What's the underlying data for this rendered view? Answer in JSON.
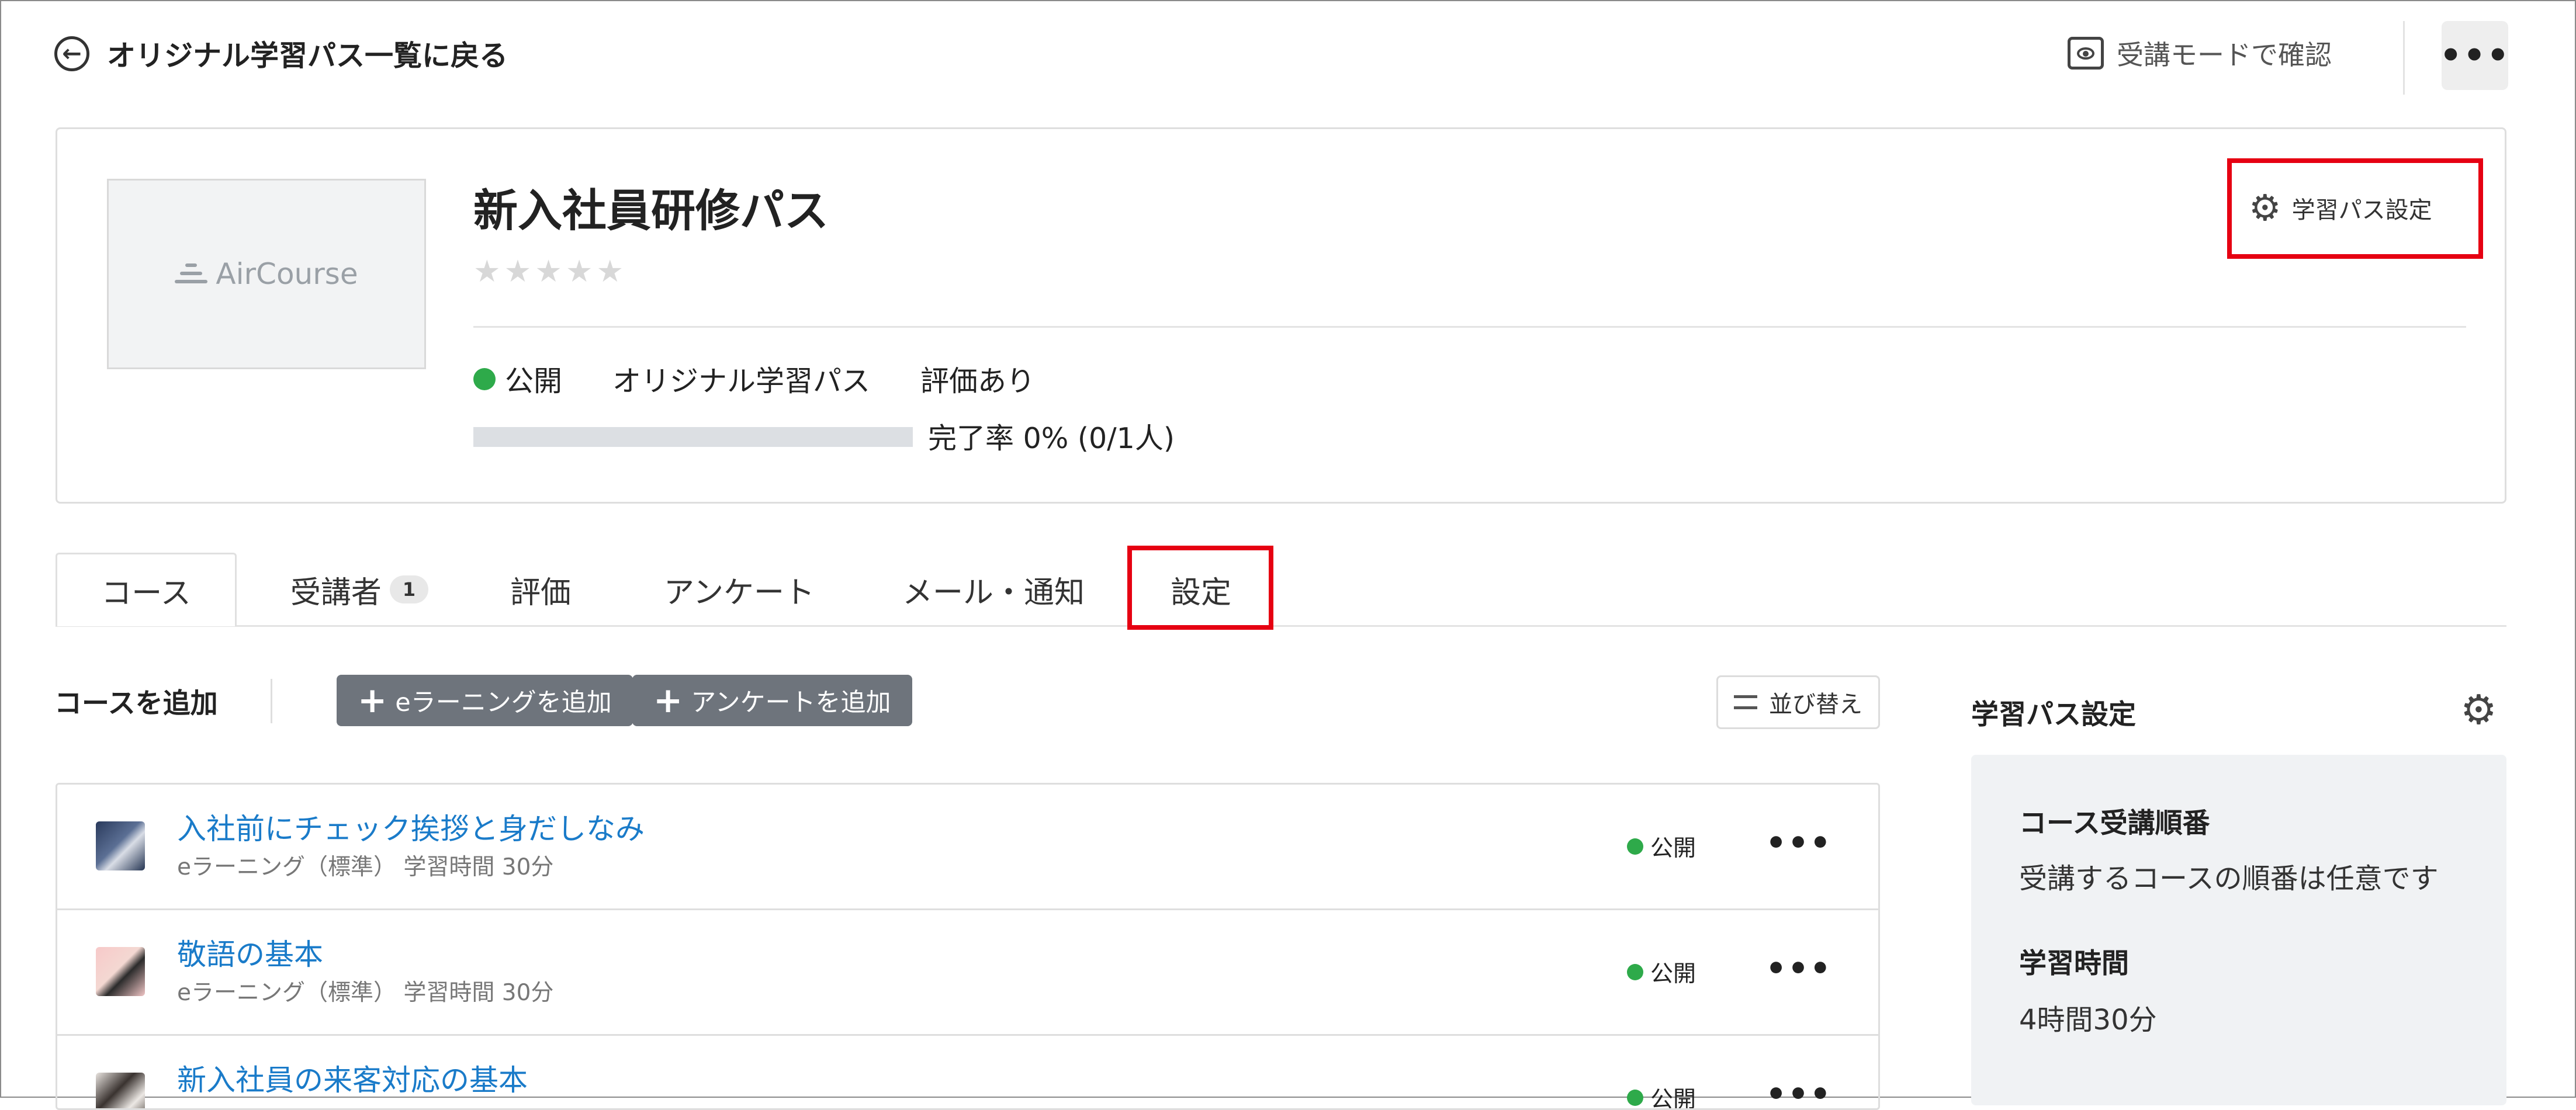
{
  "top": {
    "back_label": "オリジナル学習パス一覧に戻る",
    "preview_label": "受講モードで確認",
    "more_label": "•••"
  },
  "path": {
    "thumbnail_logo": "AirCourse",
    "title": "新入社員研修パス",
    "rating_stars": "★★★★★",
    "rating_value": 0,
    "settings_label": "学習パス設定",
    "status": "公開",
    "type": "オリジナル学習パス",
    "review": "評価あり",
    "progress_text": "完了率 0% (0/1人)",
    "progress_fraction": 0
  },
  "tabs": [
    {
      "label": "コース",
      "active": true
    },
    {
      "label": "受講者",
      "badge": "1"
    },
    {
      "label": "評価"
    },
    {
      "label": "アンケート"
    },
    {
      "label": "メール・通知"
    },
    {
      "label": "設定"
    }
  ],
  "toolbar": {
    "add_course_label": "コースを追加",
    "add_elearning_label": "eラーニングを追加",
    "add_survey_label": "アンケートを追加",
    "sort_label": "並び替え"
  },
  "courses": [
    {
      "title": "入社前にチェック挨拶と身だしなみ",
      "subtitle": "eラーニング（標準） 学習時間 30分",
      "status": "公開"
    },
    {
      "title": "敬語の基本",
      "subtitle": "eラーニング（標準） 学習時間 30分",
      "status": "公開"
    },
    {
      "title": "新入社員の来客対応の基本",
      "subtitle": "",
      "status": "公開"
    }
  ],
  "right_panel": {
    "title": "学習パス設定",
    "order_heading": "コース受講順番",
    "order_text": "受講するコースの順番は任意です",
    "time_heading": "学習時間",
    "time_text": "4時間30分"
  },
  "colors": {
    "link": "#1a7bc9",
    "status_green": "#2eaa4a",
    "highlight_red": "#e60012",
    "button_gray": "#6e747c"
  }
}
